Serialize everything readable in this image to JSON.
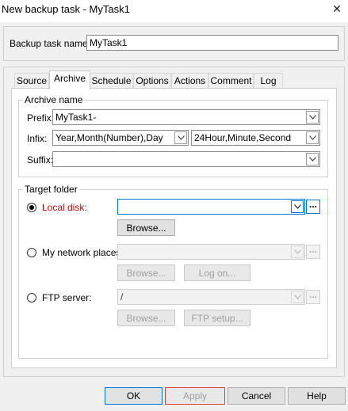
{
  "window": {
    "title": "New backup task - MyTask1",
    "close_glyph": "✕"
  },
  "task": {
    "name_label": "Backup task name:",
    "name_value": "MyTask1"
  },
  "tabs": [
    {
      "label": "Source"
    },
    {
      "label": "Archive"
    },
    {
      "label": "Schedule"
    },
    {
      "label": "Options"
    },
    {
      "label": "Actions"
    },
    {
      "label": "Comment"
    },
    {
      "label": "Log"
    }
  ],
  "archive_name": {
    "group_title": "Archive name",
    "prefix_label": "Prefix:",
    "prefix_value": "MyTask1-",
    "infix_label": "Infix:",
    "infix_date_value": "Year,Month(Number),Day",
    "infix_time_value": "24Hour,Minute,Second",
    "suffix_label": "Suffix:",
    "suffix_value": ""
  },
  "target_folder": {
    "group_title": "Target folder",
    "local_disk_label": "Local disk:",
    "local_disk_value": "",
    "ellipsis": "...",
    "browse_label": "Browse...",
    "network_label": "My network places:",
    "network_value": "",
    "logon_label": "Log on...",
    "ftp_label": "FTP server:",
    "ftp_value": "/",
    "ftp_setup_label": "FTP setup..."
  },
  "footer": {
    "ok": "OK",
    "apply": "Apply",
    "cancel": "Cancel",
    "help": "Help"
  }
}
